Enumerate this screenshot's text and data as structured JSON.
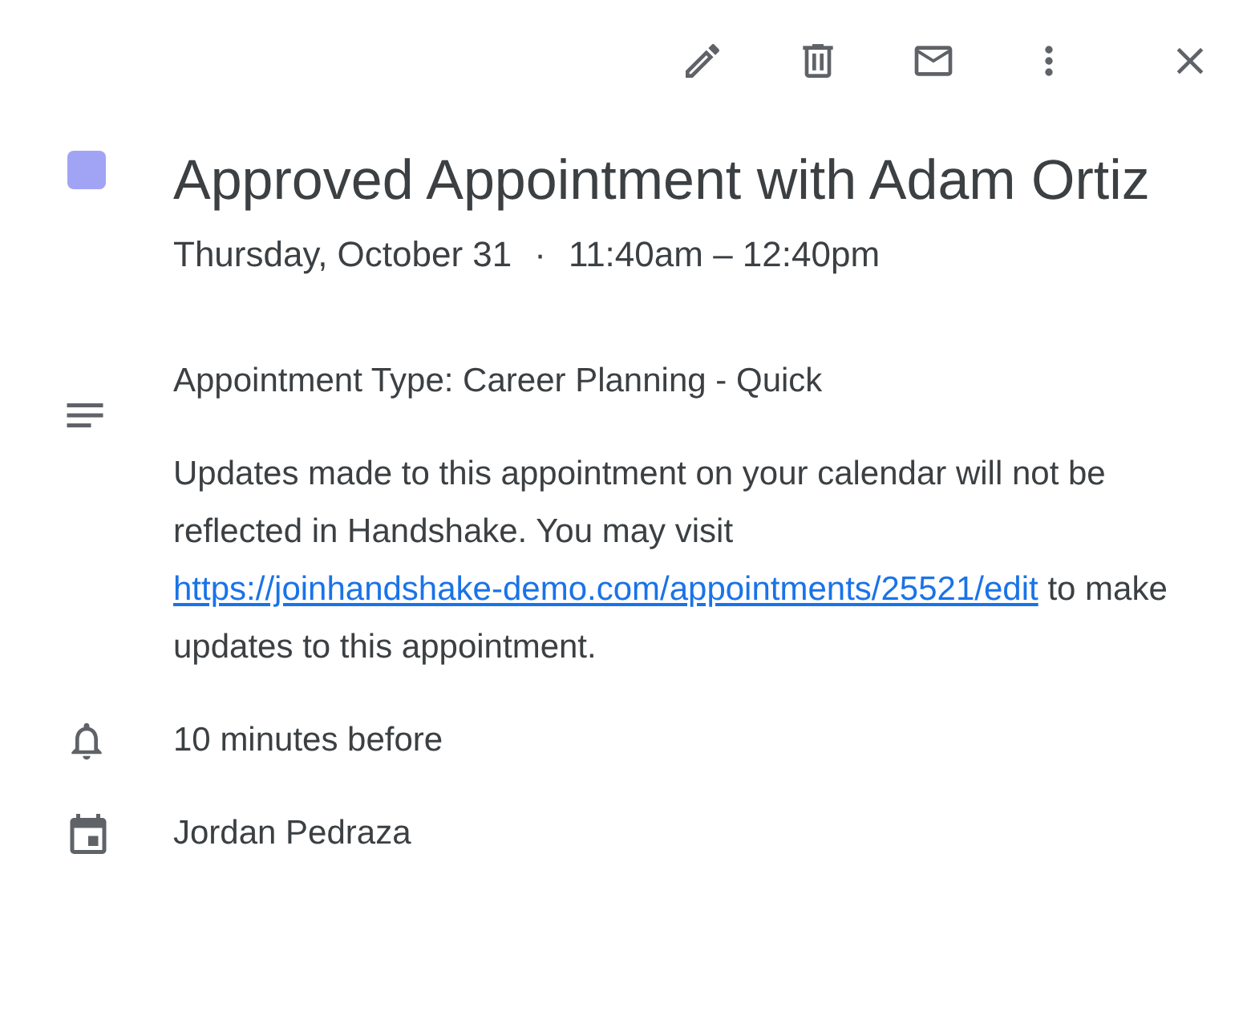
{
  "toolbar": [
    {
      "kind": "edit"
    },
    {
      "kind": "delete"
    },
    {
      "kind": "email"
    },
    {
      "kind": "more"
    },
    {
      "kind": "close"
    }
  ],
  "event": {
    "color": "#a1a4f5",
    "title": "Approved Appointment with Adam Ortiz",
    "date": "Thursday, October 31",
    "separator": "·",
    "time": "11:40am – 12:40pm"
  },
  "description": {
    "type_line": "Appointment Type: Career Planning - Quick",
    "note_before": "Updates made to this appointment on your calendar will not be reflected in Handshake. You may visit",
    "link": "https://joinhandshake-demo.com/appointments/25521/edit",
    "note_after": "to make updates to this appointment."
  },
  "reminder": "10 minutes before",
  "calendar": "Jordan Pedraza"
}
